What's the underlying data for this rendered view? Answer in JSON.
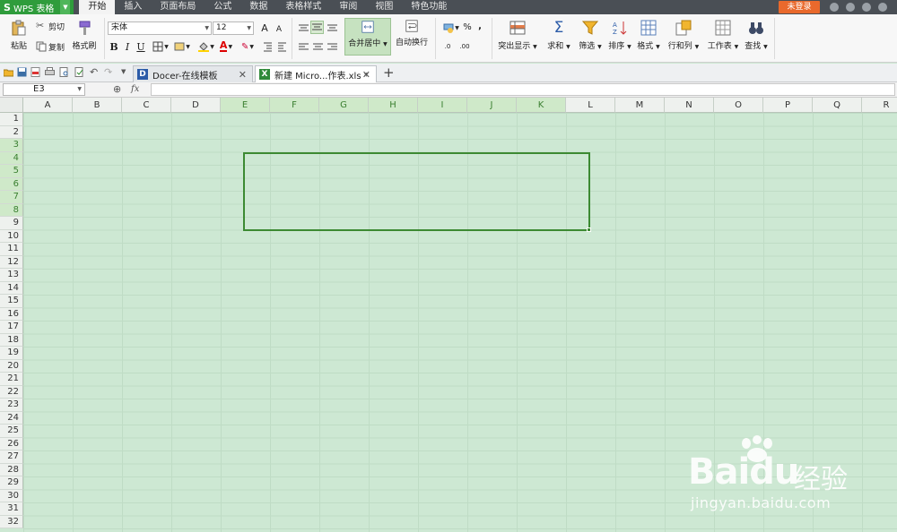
{
  "app": {
    "name": "WPS 表格",
    "logo": "S"
  },
  "menu": [
    "开始",
    "插入",
    "页面布局",
    "公式",
    "数据",
    "表格样式",
    "审阅",
    "视图",
    "特色功能"
  ],
  "login_label": "未登录",
  "ribbon": {
    "paste": "粘贴",
    "cut": "剪切",
    "copy": "复制",
    "format_painter": "格式刷",
    "font_name": "宋体",
    "font_size": "12",
    "bold": "B",
    "italic": "I",
    "underline": "U",
    "merge_center": "合并居中",
    "wrap_text": "自动换行",
    "percent": "%",
    "comma": ",",
    "inc_dec": ".0",
    "dec_dec": ".00",
    "conditional": "突出显示",
    "sum": "求和",
    "filter": "筛选",
    "sort": "排序",
    "format": "格式",
    "rows_cols": "行和列",
    "worksheet": "工作表",
    "find": "查找",
    "font_grow": "A",
    "font_shrink": "A",
    "font_color_letter": "A"
  },
  "tabs": [
    {
      "label": "Docer-在线模板",
      "icon_letter": "D"
    },
    {
      "label": "新建 Micro...作表.xls *",
      "icon_letter": "X"
    }
  ],
  "namebox": "E3",
  "fx_label": "fx",
  "columns": [
    "A",
    "B",
    "C",
    "D",
    "E",
    "F",
    "G",
    "H",
    "I",
    "J",
    "K",
    "L",
    "M",
    "N",
    "O",
    "P",
    "Q",
    "R"
  ],
  "rows": [
    "1",
    "2",
    "3",
    "4",
    "5",
    "6",
    "7",
    "8",
    "9",
    "10",
    "11",
    "12",
    "13",
    "14",
    "15",
    "16",
    "17",
    "18",
    "19",
    "20",
    "21",
    "22",
    "23",
    "24",
    "25",
    "26",
    "27",
    "28",
    "29",
    "30",
    "31",
    "32"
  ],
  "selected_columns": [
    "E",
    "F",
    "G",
    "H",
    "I",
    "J",
    "K"
  ],
  "selected_rows": [
    "3",
    "4",
    "5",
    "6",
    "7",
    "8"
  ],
  "colors": {
    "accent": "#2f9c3c",
    "sheet_bg": "#cde8d3",
    "selection": "#3c8a32",
    "login": "#e9692c"
  },
  "watermark": {
    "brand": "Bai",
    "brand2": "du",
    "sub": "经验",
    "url": "jingyan.baidu.com"
  }
}
